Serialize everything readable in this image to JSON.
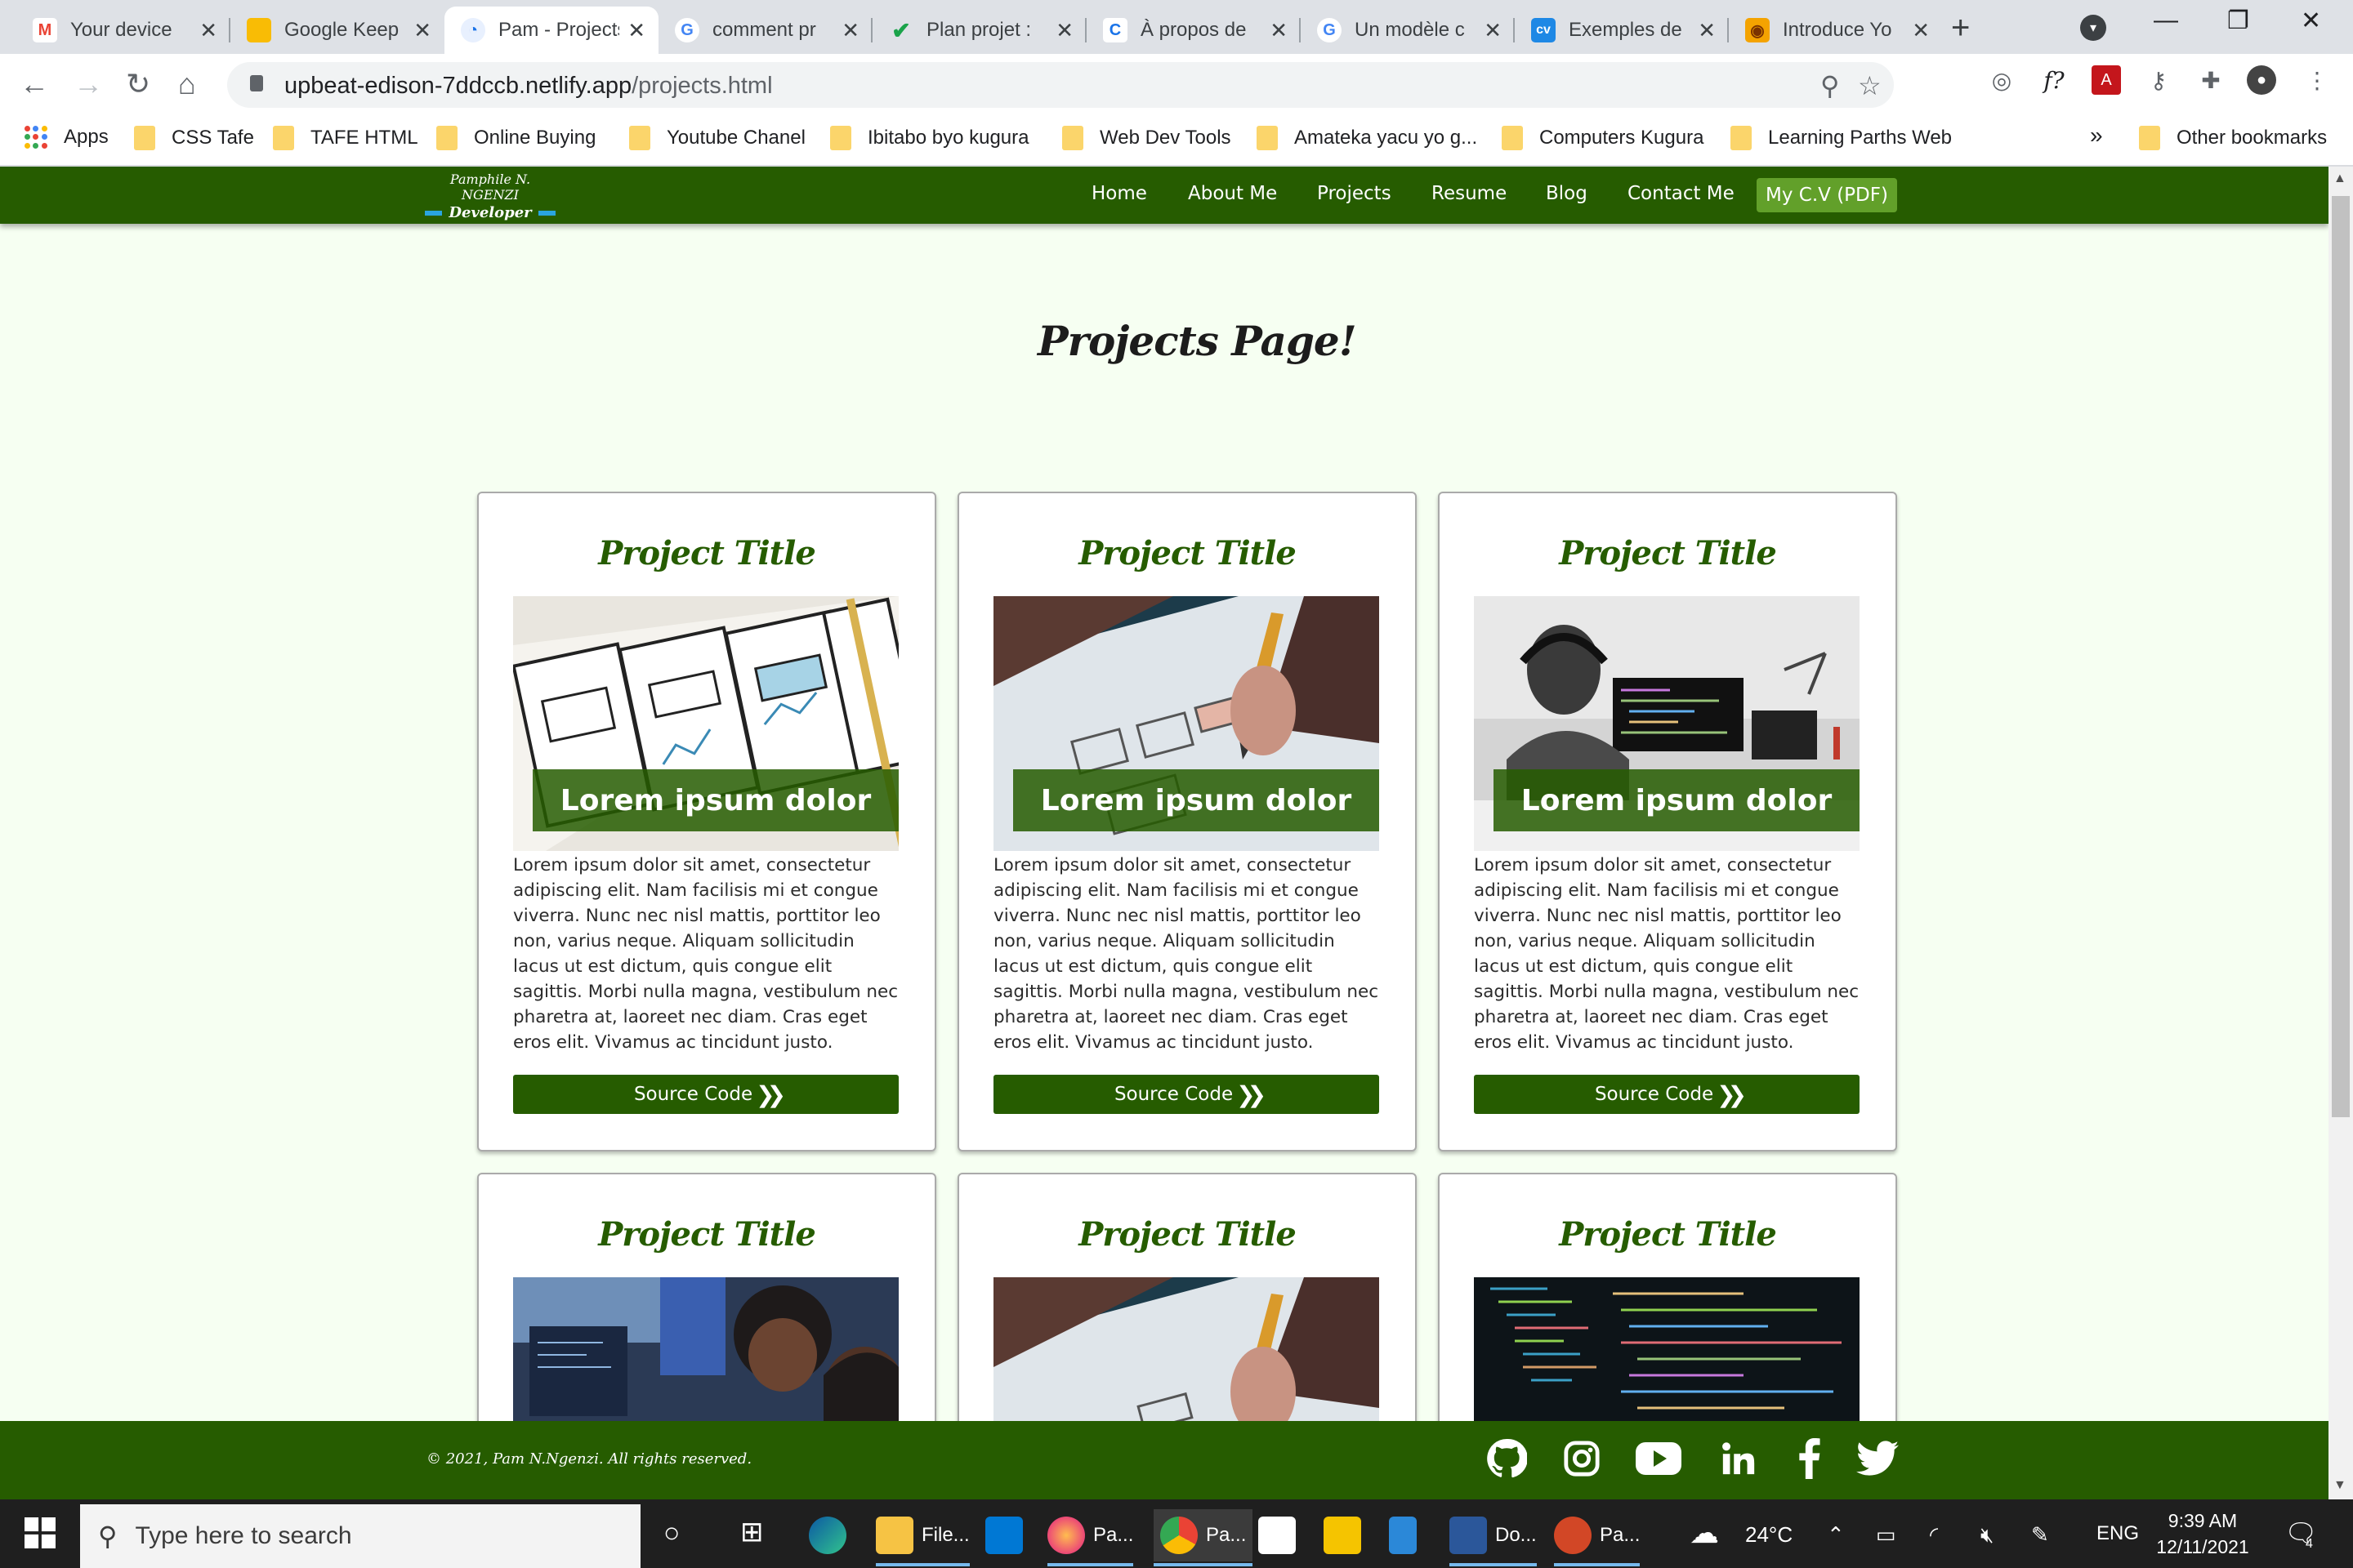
{
  "browser": {
    "tabs": [
      {
        "title": "Your device",
        "fav_color": "#ffffff",
        "fav_glyph": "M",
        "fav_text": "#ea4335"
      },
      {
        "title": "Google Keep",
        "fav_color": "#f9bc05",
        "fav_glyph": "",
        "fav_text": "#fff"
      },
      {
        "title": "Pam - Projects",
        "fav_color": "#e8f0fe",
        "fav_glyph": "◔",
        "fav_text": "#1a73e8"
      },
      {
        "title": "comment pr",
        "fav_color": "#ffffff",
        "fav_glyph": "G",
        "fav_text": "#4285f4"
      },
      {
        "title": "Plan projet :",
        "fav_color": "#ffffff",
        "fav_glyph": "✔",
        "fav_text": "#1aa34a"
      },
      {
        "title": "À propos de",
        "fav_color": "#ffffff",
        "fav_glyph": "C",
        "fav_text": "#1a73e8"
      },
      {
        "title": "Un modèle c",
        "fav_color": "#ffffff",
        "fav_glyph": "G",
        "fav_text": "#4285f4"
      },
      {
        "title": "Exemples de",
        "fav_color": "#1e88e5",
        "fav_glyph": "cv",
        "fav_text": "#fff"
      },
      {
        "title": "Introduce Yo",
        "fav_color": "#f4a300",
        "fav_glyph": "◉",
        "fav_text": "#7a3200"
      }
    ],
    "url_host": "upbeat-edison-7ddccb.netlify.app",
    "url_path": "/projects.html",
    "bookmarks": [
      "Apps",
      "CSS Tafe",
      "TAFE HTML",
      "Online  Buying",
      "Youtube Chanel",
      "Ibitabo byo kugura",
      "Web Dev Tools",
      "Amateka yacu yo g...",
      "Computers Kugura",
      "Learning Parths Web"
    ],
    "overflow": "»",
    "other_bookmarks": "Other bookmarks"
  },
  "site": {
    "logo_line1": "Pamphile N. NGENZI",
    "logo_line2": "Developer",
    "nav": [
      "Home",
      "About Me",
      "Projects",
      "Resume",
      "Blog",
      "Contact Me"
    ],
    "cv_button": "My C.V (PDF)",
    "page_title": "Projects Page!",
    "cards": [
      {
        "title": "Project Title",
        "caption": "Lorem ipsum dolor",
        "body": "Lorem ipsum dolor sit amet, consectetur adipiscing elit. Nam facilisis mi et congue viverra. Nunc nec nisl mattis, porttitor leo non, varius neque. Aliquam sollicitudin lacus ut est dictum, quis congue elit sagittis. Morbi nulla magna, vestibulum nec pharetra at, laoreet nec diam. Cras eget eros elit. Vivamus ac tincidunt justo.",
        "button": "Source Code",
        "image": "wireframe-sketch"
      },
      {
        "title": "Project Title",
        "caption": "Lorem ipsum dolor",
        "body": "Lorem ipsum dolor sit amet, consectetur adipiscing elit. Nam facilisis mi et congue viverra. Nunc nec nisl mattis, porttitor leo non, varius neque. Aliquam sollicitudin lacus ut est dictum, quis congue elit sagittis. Morbi nulla magna, vestibulum nec pharetra at, laoreet nec diam. Cras eget eros elit. Vivamus ac tincidunt justo.",
        "button": "Source Code",
        "image": "pencil-drawing"
      },
      {
        "title": "Project Title",
        "caption": "Lorem ipsum dolor",
        "body": "Lorem ipsum dolor sit amet, consectetur adipiscing elit. Nam facilisis mi et congue viverra. Nunc nec nisl mattis, porttitor leo non, varius neque. Aliquam sollicitudin lacus ut est dictum, quis congue elit sagittis. Morbi nulla magna, vestibulum nec pharetra at, laoreet nec diam. Cras eget eros elit. Vivamus ac tincidunt justo.",
        "button": "Source Code",
        "image": "developer-at-desk"
      },
      {
        "title": "Project Title",
        "image": "students-coding"
      },
      {
        "title": "Project Title",
        "image": "pencil-drawing"
      },
      {
        "title": "Project Title",
        "image": "code-screen"
      }
    ],
    "footer_copy": "© 2021, Pam N.Ngenzi. All rights reserved.",
    "social": [
      "github-icon",
      "instagram-icon",
      "youtube-icon",
      "linkedin-icon",
      "facebook-icon",
      "twitter-icon"
    ]
  },
  "taskbar": {
    "search_placeholder": "Type here to search",
    "apps": [
      "File...",
      "Pa...",
      "Pa...",
      "Do...",
      "Pa..."
    ],
    "weather": "24°C",
    "lang": "ENG",
    "time": "9:39 AM",
    "date": "12/11/2021",
    "notifications": "4"
  },
  "colors": {
    "brand_green": "#265c00",
    "accent_green": "#62a02a",
    "page_bg": "#f6fff2"
  }
}
